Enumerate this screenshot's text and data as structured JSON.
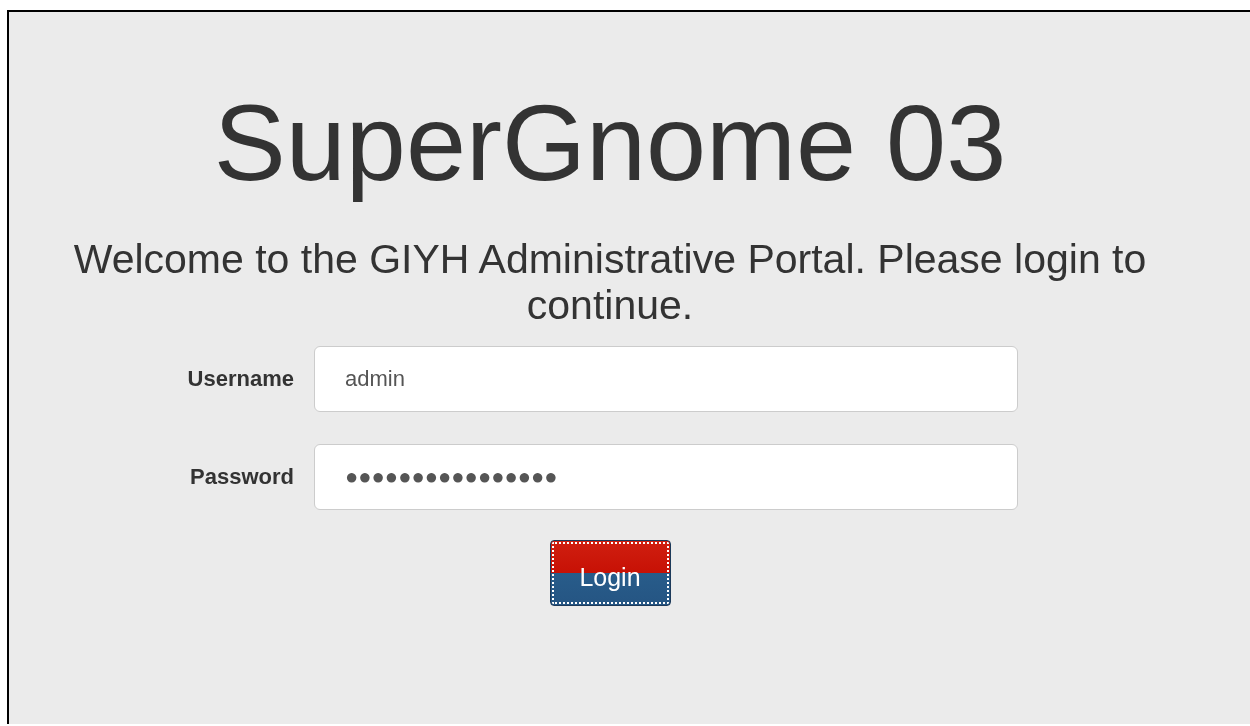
{
  "title": "SuperGnome 03",
  "welcome": "Welcome to the GIYH Administrative Portal. Please login to continue.",
  "fields": [
    {
      "label": "Username",
      "value": "admin"
    },
    {
      "label": "Password",
      "value": "●●●●●●●●●●●●●●●●"
    }
  ],
  "button": {
    "label": "Login",
    "focused": true
  }
}
